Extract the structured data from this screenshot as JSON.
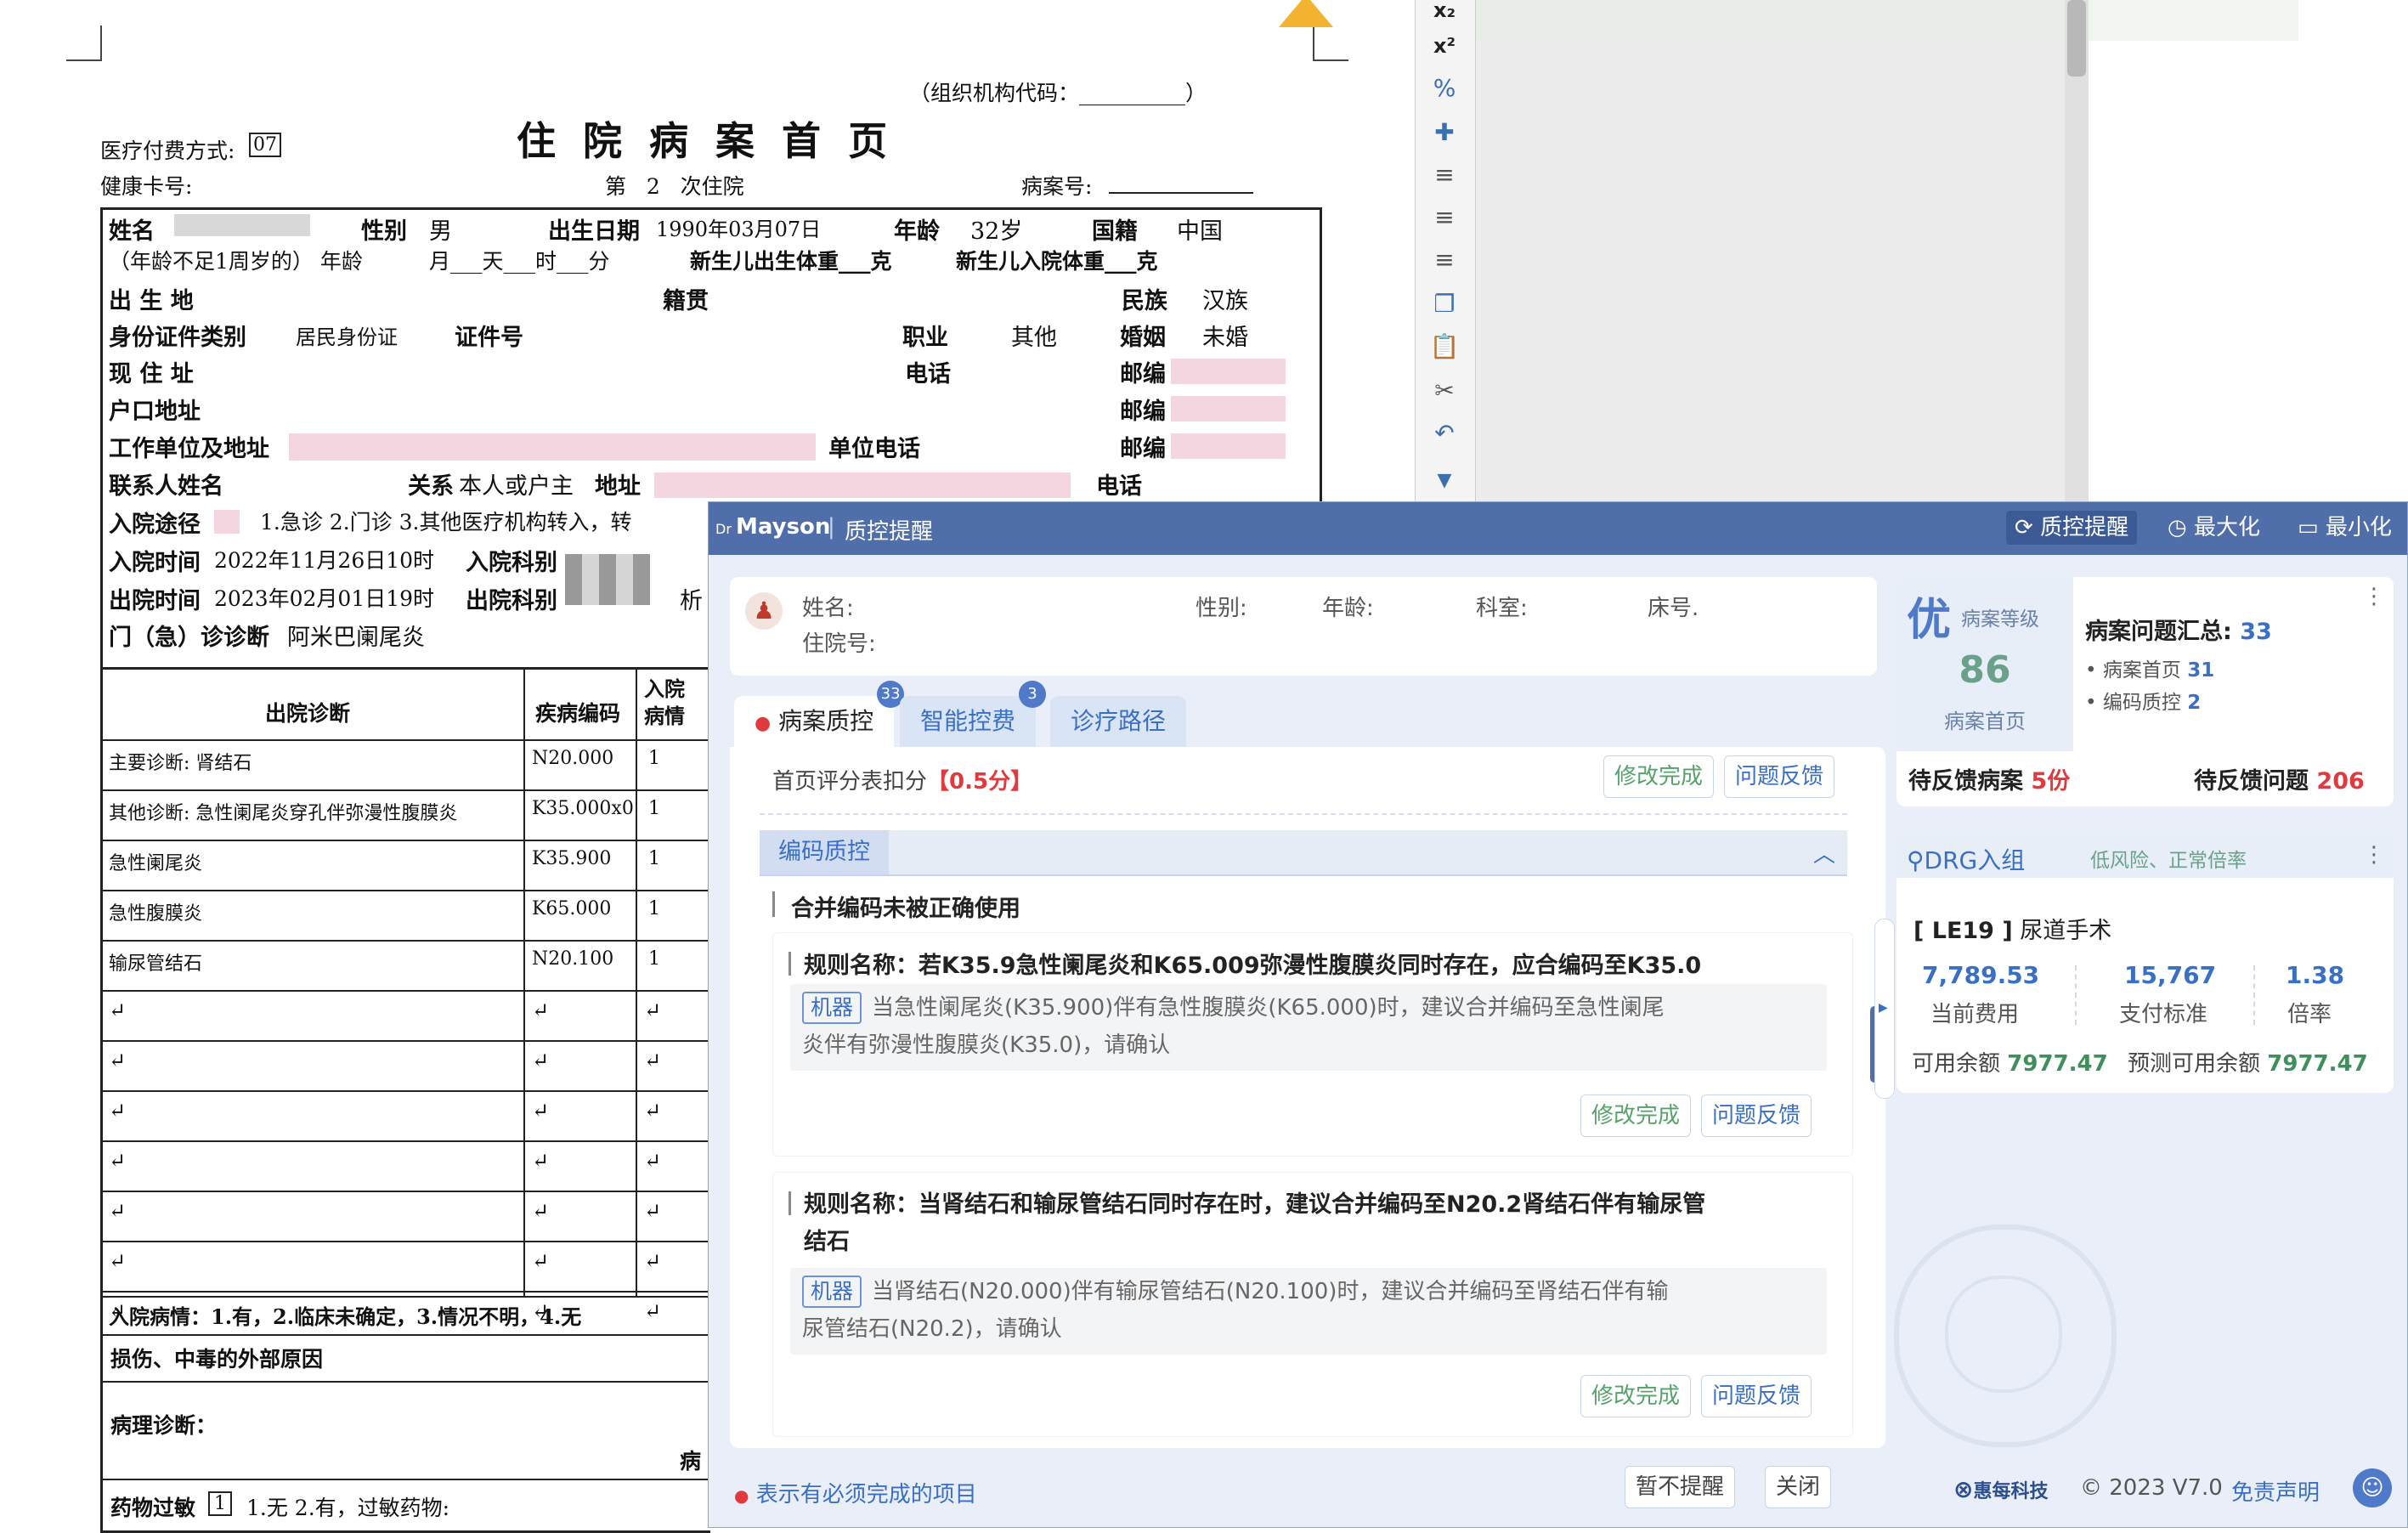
{
  "document": {
    "org_code": "（组织机构代码：__________）",
    "title": "住 院 病 案 首 页",
    "pay_label": "医疗付费方式:",
    "pay_value": "07",
    "health_card": "健康卡号:",
    "admission_count_prefix": "第",
    "admission_count": "2",
    "admission_count_suffix": "次住院",
    "record_no": "病案号:",
    "name_label": "姓名",
    "sex_label": "性别",
    "sex_value": "男",
    "dob_label": "出生日期",
    "dob_value": "1990年03月07日",
    "age_label": "年龄",
    "age_value": "32岁",
    "nationality_label": "国籍",
    "nationality_value": "中国",
    "infant_age": "（年龄不足1周岁的） 年龄",
    "infant_units": "月___天___时___分",
    "newborn_birth_weight": "新生儿出生体重___克",
    "newborn_admit_weight": "新生儿入院体重___克",
    "birthplace": "出 生 地",
    "native_place": "籍贯",
    "ethnicity_label": "民族",
    "ethnicity_value": "汉族",
    "id_type_label": "身份证件类别",
    "id_type_value": "居民身份证",
    "id_no_label": "证件号",
    "job_label": "职业",
    "job_value": "其他",
    "marital_label": "婚姻",
    "marital_value": "未婚",
    "address_label": "现 住 址",
    "phone_label": "电话",
    "postcode_label": "邮编",
    "hukou_label": "户口地址",
    "work_label": "工作单位及地址",
    "work_phone_label": "单位电话",
    "contact_label": "联系人姓名",
    "relation_label": "关系",
    "relation_value": "本人或户主",
    "contact_addr_label": "地址",
    "admit_route_label": "入院途径",
    "admit_route_options": "1.急诊  2.门诊  3.其他医疗机构转入，转",
    "admit_time_label": "入院时间",
    "admit_time_value": "2022年11月26日10时",
    "admit_dept_label": "入院科别",
    "discharge_time_label": "出院时间",
    "discharge_time_value": "2023年02月01日19时",
    "discharge_dept_label": "出院科别",
    "discharge_dept_hint": "析",
    "outpatient_diag_label": "门（急）诊诊断",
    "outpatient_diag_value": "阿米巴阑尾炎",
    "table_head_diag": "出院诊断",
    "table_head_code": "疾病编码",
    "table_head_admit": "入院病情",
    "diagnoses": [
      {
        "name": "主要诊断: 肾结石",
        "code": "N20.000",
        "cond": "1"
      },
      {
        "name": "其他诊断: 急性阑尾炎穿孔伴弥漫性腹膜炎",
        "code": "K35.000x0",
        "cond": "1"
      },
      {
        "name": "急性阑尾炎",
        "code": "K35.900",
        "cond": "1"
      },
      {
        "name": "急性腹膜炎",
        "code": "K65.000",
        "cond": "1"
      },
      {
        "name": "输尿管结石",
        "code": "N20.100",
        "cond": "1"
      }
    ],
    "admit_cond_note": "入院病情：1.有，2.临床未确定，3.情况不明，4.无",
    "injury_label": "损伤、中毒的外部原因",
    "pathology_label": "病理诊断：",
    "pathology_suffix": "病",
    "allergy_label": "药物过敏",
    "allergy_value": "1",
    "allergy_options": "1.无 2.有，过敏药物:"
  },
  "panel": {
    "brand_prefix": "Dr",
    "brand": "Mayson",
    "title": "质控提醒",
    "actions": {
      "qc": "质控提醒",
      "maximize": "最大化",
      "minimize": "最小化"
    },
    "patient": {
      "name": "姓名:",
      "sex": "性别:",
      "age": "年龄:",
      "dept": "科室:",
      "bed": "床号.",
      "admit_no": "住院号:"
    },
    "tabs": [
      {
        "label": "病案质控",
        "badge": "33"
      },
      {
        "label": "智能控费",
        "badge": "3"
      },
      {
        "label": "诊疗路径",
        "badge": ""
      }
    ],
    "score_text": "首页评分表扣分",
    "score_value": "【0.5分】",
    "buttons": {
      "done": "修改完成",
      "feedback": "问题反馈"
    },
    "section_title": "编码质控",
    "issue_title": "合并编码未被正确使用",
    "machine_tag": "机器",
    "rules": [
      {
        "title": "规则名称：若K35.9急性阑尾炎和K65.009弥漫性腹膜炎同时存在，应合编码至K35.0",
        "desc_line1": "当急性阑尾炎(K35.900)伴有急性腹膜炎(K65.000)时，建议合并编码至急性阑尾",
        "desc_line2": "炎伴有弥漫性腹膜炎(K35.0)，请确认"
      },
      {
        "title_line1": "规则名称：当肾结石和输尿管结石同时存在时，建议合并编码至N20.2肾结石伴有输尿管",
        "title_line2": "结石",
        "desc_line1": "当肾结石(N20.000)伴有输尿管结石(N20.100)时，建议合并编码至肾结石伴有输",
        "desc_line2": "尿管结石(N20.2)，请确认"
      }
    ],
    "footer_note": "表示有必须完成的项目",
    "footer_buttons": {
      "snooze": "暂不提醒",
      "close": "关闭"
    },
    "quality": {
      "grade": "优",
      "grade_label": "病案等级",
      "score": "86",
      "score_label": "病案首页",
      "summary_label": "病案问题汇总:",
      "summary_value": "33",
      "items": [
        {
          "label": "病案首页",
          "value": "31"
        },
        {
          "label": "编码质控",
          "value": "2"
        }
      ],
      "pending_cases_label": "待反馈病案",
      "pending_cases_value": "5份",
      "pending_issues_label": "待反馈问题",
      "pending_issues_value": "206"
    },
    "drg": {
      "title": "DRG入组",
      "risk_tag": "低风险、正常倍率",
      "group_code": "[ LE19 ]",
      "group_name": "尿道手术",
      "current_cost": "7,789.53",
      "current_cost_label": "当前费用",
      "standard": "15,767",
      "standard_label": "支付标准",
      "ratio": "1.38",
      "ratio_label": "倍率",
      "available_label": "可用余额",
      "available_value": "7977.47",
      "predicted_label": "预测可用余额",
      "predicted_value": "7977.47"
    },
    "footer_right": {
      "company": "惠每科技",
      "copyright": "© 2023 V7.0",
      "disclaimer": "免责声明"
    }
  }
}
